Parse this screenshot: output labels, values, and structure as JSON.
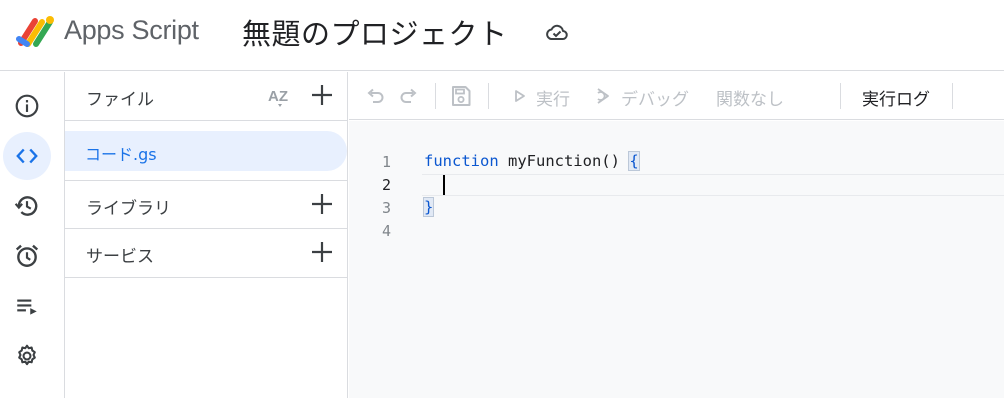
{
  "header": {
    "app_name": "Apps Script",
    "project_title": "無題のプロジェクト",
    "cloud_status_icon": "cloud-done-icon"
  },
  "rail": {
    "items": [
      {
        "icon": "info-icon",
        "label": "概要"
      },
      {
        "icon": "code-icon",
        "label": "エディタ",
        "active": true
      },
      {
        "icon": "history-icon",
        "label": "実行数"
      },
      {
        "icon": "alarm-icon",
        "label": "トリガー"
      },
      {
        "icon": "playlist-icon",
        "label": "実行"
      },
      {
        "icon": "gear-icon",
        "label": "プロジェクトの設定"
      }
    ]
  },
  "files_panel": {
    "files_header": "ファイル",
    "sort_icon": "az-sort-icon",
    "add_icon": "plus-icon",
    "files": [
      {
        "name": "コード.gs",
        "selected": true
      }
    ],
    "libraries_label": "ライブラリ",
    "services_label": "サービス"
  },
  "toolbar": {
    "undo_icon": "undo-icon",
    "redo_icon": "redo-icon",
    "save_icon": "save-icon",
    "run_label": "実行",
    "debug_label": "デバッグ",
    "function_select": "関数なし",
    "log_label": "実行ログ"
  },
  "editor": {
    "line_numbers": [
      "1",
      "2",
      "3",
      "4"
    ],
    "lines": [
      {
        "keyword": "function",
        "rest": " myFunction() ",
        "brace": "{"
      },
      {
        "text": ""
      },
      {
        "brace": "}"
      },
      {
        "text": ""
      }
    ],
    "current_line": "2"
  },
  "colors": {
    "accent": "#1a73e8",
    "active_bg": "#e8f0fe",
    "keyword": "#0b57d0",
    "border": "#dadce0",
    "editor_bg": "#f8f9fa"
  }
}
